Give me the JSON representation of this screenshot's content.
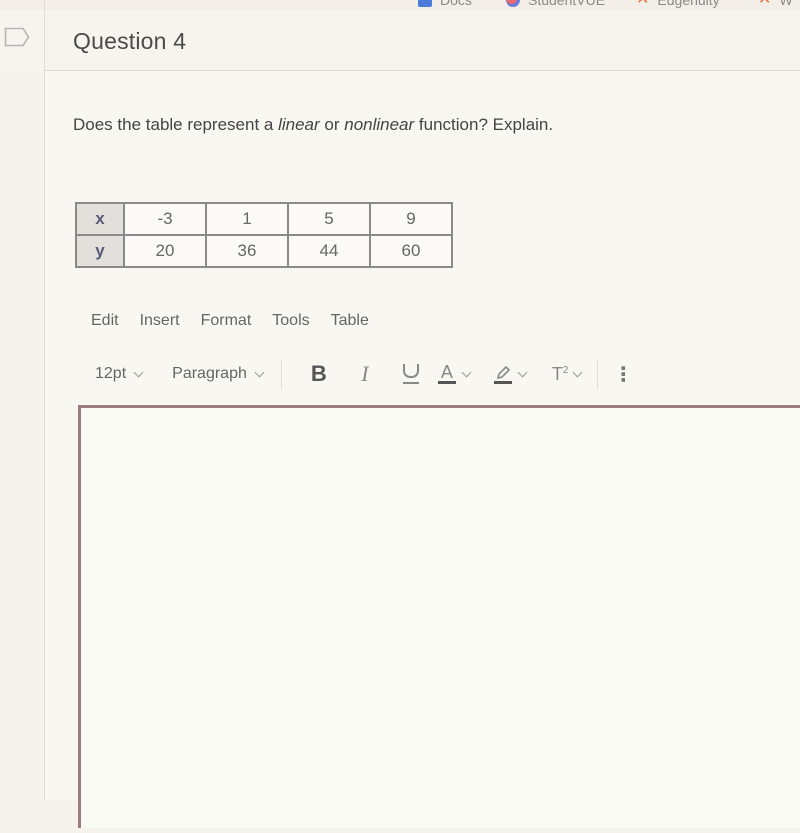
{
  "bookmarks": [
    {
      "label": "Docs",
      "icon": "docs-icon"
    },
    {
      "label": "StudentVUE",
      "icon": "studentvue-icon"
    },
    {
      "label": "Edgenuity",
      "icon": "edgenuity-icon"
    },
    {
      "label": "W",
      "icon": "edgenuity-icon"
    }
  ],
  "question": {
    "title": "Question 4",
    "flag_icon": "flag-icon",
    "prompt_prefix": "Does the table represent a ",
    "prompt_em1": "linear",
    "prompt_mid": " or ",
    "prompt_em2": "nonlinear",
    "prompt_suffix": " function? Explain."
  },
  "table": {
    "row_labels": [
      "x",
      "y"
    ],
    "x": [
      "-3",
      "1",
      "5",
      "9"
    ],
    "y": [
      "20",
      "36",
      "44",
      "60"
    ]
  },
  "editor": {
    "menu": [
      "Edit",
      "Insert",
      "Format",
      "Tools",
      "Table"
    ],
    "font_size": "12pt",
    "block_format": "Paragraph",
    "buttons": {
      "bold": "B",
      "italic": "I",
      "text_color": "A",
      "superscript": "T",
      "superscript_mark": "2",
      "more": "⋮"
    },
    "content": ""
  }
}
